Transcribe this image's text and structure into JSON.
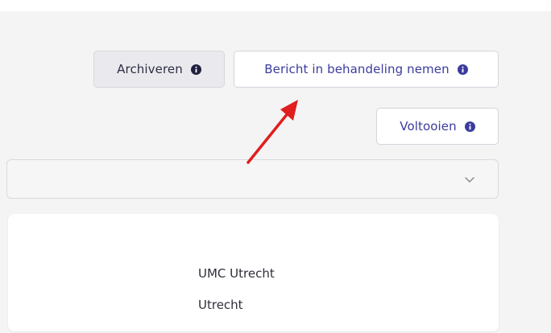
{
  "actions": {
    "archive_label": "Archiveren",
    "handle_label": "Bericht in behandeling nemen",
    "complete_label": "Voltooien"
  },
  "icons": {
    "info": "info-icon",
    "dropdown": "chevron-down-icon",
    "annotation": "red-arrow"
  },
  "dropdown": {
    "value": ""
  },
  "card": {
    "organization": "UMC Utrecht",
    "city": "Utrecht"
  },
  "colors": {
    "accent": "#3b3b9e",
    "annotation_arrow": "#e01e1e",
    "background": "#f4f4f4"
  }
}
